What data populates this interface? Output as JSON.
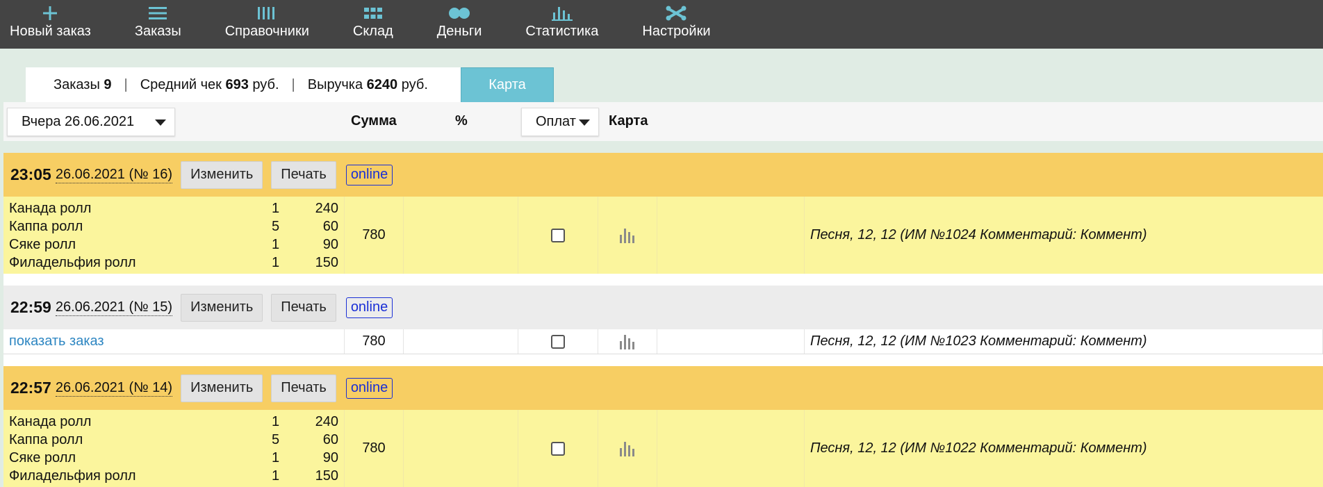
{
  "nav": {
    "items": [
      {
        "key": "new-order",
        "label": "Новый заказ",
        "icon": "plus-icon"
      },
      {
        "key": "orders",
        "label": "Заказы",
        "icon": "menu-lines-icon"
      },
      {
        "key": "directories",
        "label": "Справочники",
        "icon": "columns-icon"
      },
      {
        "key": "warehouse",
        "label": "Склад",
        "icon": "grid-icon"
      },
      {
        "key": "money",
        "label": "Деньги",
        "icon": "coins-icon"
      },
      {
        "key": "statistics",
        "label": "Статистика",
        "icon": "bar-chart-icon"
      },
      {
        "key": "settings",
        "label": "Настройки",
        "icon": "tools-icon"
      }
    ],
    "icon_color": "#6cc3d4"
  },
  "stats": {
    "orders_label": "Заказы",
    "orders_value": "9",
    "avg_label": "Средний чек",
    "avg_value": "693",
    "avg_unit": "руб.",
    "revenue_label": "Выручка",
    "revenue_value": "6240",
    "revenue_unit": "руб.",
    "map_tab": "Карта"
  },
  "filters": {
    "date_value": "Вчера 26.06.2021",
    "sum_header": "Сумма",
    "pct_header": "%",
    "payment_value": "Оплат",
    "card_header": "Карта"
  },
  "buttons": {
    "edit": "Изменить",
    "print": "Печать",
    "online": "online",
    "show_order": "показать заказ"
  },
  "orders": [
    {
      "time": "23:05",
      "date": "26.06.2021 (№ 16)",
      "style": "yellow",
      "items": [
        {
          "name": "Канада ролл",
          "qty": "1",
          "price": "240"
        },
        {
          "name": "Каппа ролл",
          "qty": "5",
          "price": "60"
        },
        {
          "name": "Сяке ролл",
          "qty": "1",
          "price": "90"
        },
        {
          "name": "Филадельфия ролл",
          "qty": "1",
          "price": "150"
        }
      ],
      "sum": "780",
      "comment": "Песня, 12, 12 (ИМ №1024 Комментарий: Коммент)"
    },
    {
      "time": "22:59",
      "date": "26.06.2021 (№ 15)",
      "style": "grey",
      "items": [],
      "sum": "780",
      "comment": "Песня, 12, 12 (ИМ №1023 Комментарий: Коммент)"
    },
    {
      "time": "22:57",
      "date": "26.06.2021 (№ 14)",
      "style": "yellow",
      "items": [
        {
          "name": "Канада ролл",
          "qty": "1",
          "price": "240"
        },
        {
          "name": "Каппа ролл",
          "qty": "5",
          "price": "60"
        },
        {
          "name": "Сяке ролл",
          "qty": "1",
          "price": "90"
        },
        {
          "name": "Филадельфия ролл",
          "qty": "1",
          "price": "150"
        }
      ],
      "sum": "780",
      "comment": "Песня, 12, 12 (ИМ №1022 Комментарий: Коммент)"
    }
  ]
}
